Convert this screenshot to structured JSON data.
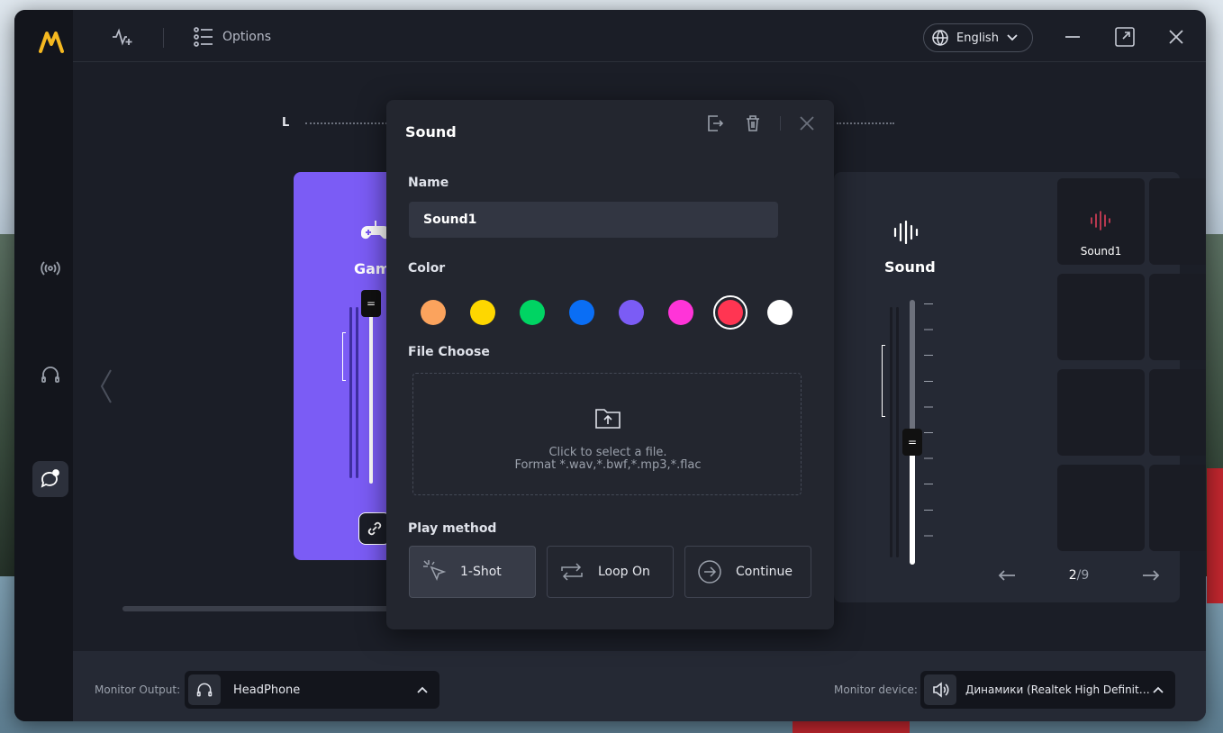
{
  "toolbar": {
    "options_label": "Options"
  },
  "language": {
    "selected": "English"
  },
  "mixer": {
    "channel_label": "L"
  },
  "game_card": {
    "title": "Gam"
  },
  "sound_panel": {
    "title": "Sound",
    "pads": [
      {
        "label": "Sound1",
        "color": "#e0405a"
      }
    ],
    "pager": {
      "current": "2",
      "total": "/9"
    }
  },
  "footer": {
    "monitor_output_label": "Monitor Output:",
    "monitor_output_value": "HeadPhone",
    "monitor_device_label": "Monitor device:",
    "monitor_device_value": "Динамики (Realtek High Definiti..."
  },
  "modal": {
    "title": "Sound",
    "name_label": "Name",
    "name_value": "Sound1",
    "color_label": "Color",
    "colors": [
      "#fba35d",
      "#fed700",
      "#00d463",
      "#0a6ef5",
      "#7b5cf5",
      "#ff34d8",
      "#ff3552",
      "#ffffff"
    ],
    "selected_color": "#ff3552",
    "file_label": "File Choose",
    "file_hint_1": "Click to select a file.",
    "file_hint_2": "Format *.wav,*.bwf,*.mp3,*.flac",
    "play_label": "Play method",
    "play_methods": [
      {
        "label": "1-Shot",
        "icon": "click-icon"
      },
      {
        "label": "Loop On",
        "icon": "loop-icon"
      },
      {
        "label": "Continue",
        "icon": "arrow-right-circle-icon"
      }
    ]
  },
  "accent": "#7b5cf5"
}
